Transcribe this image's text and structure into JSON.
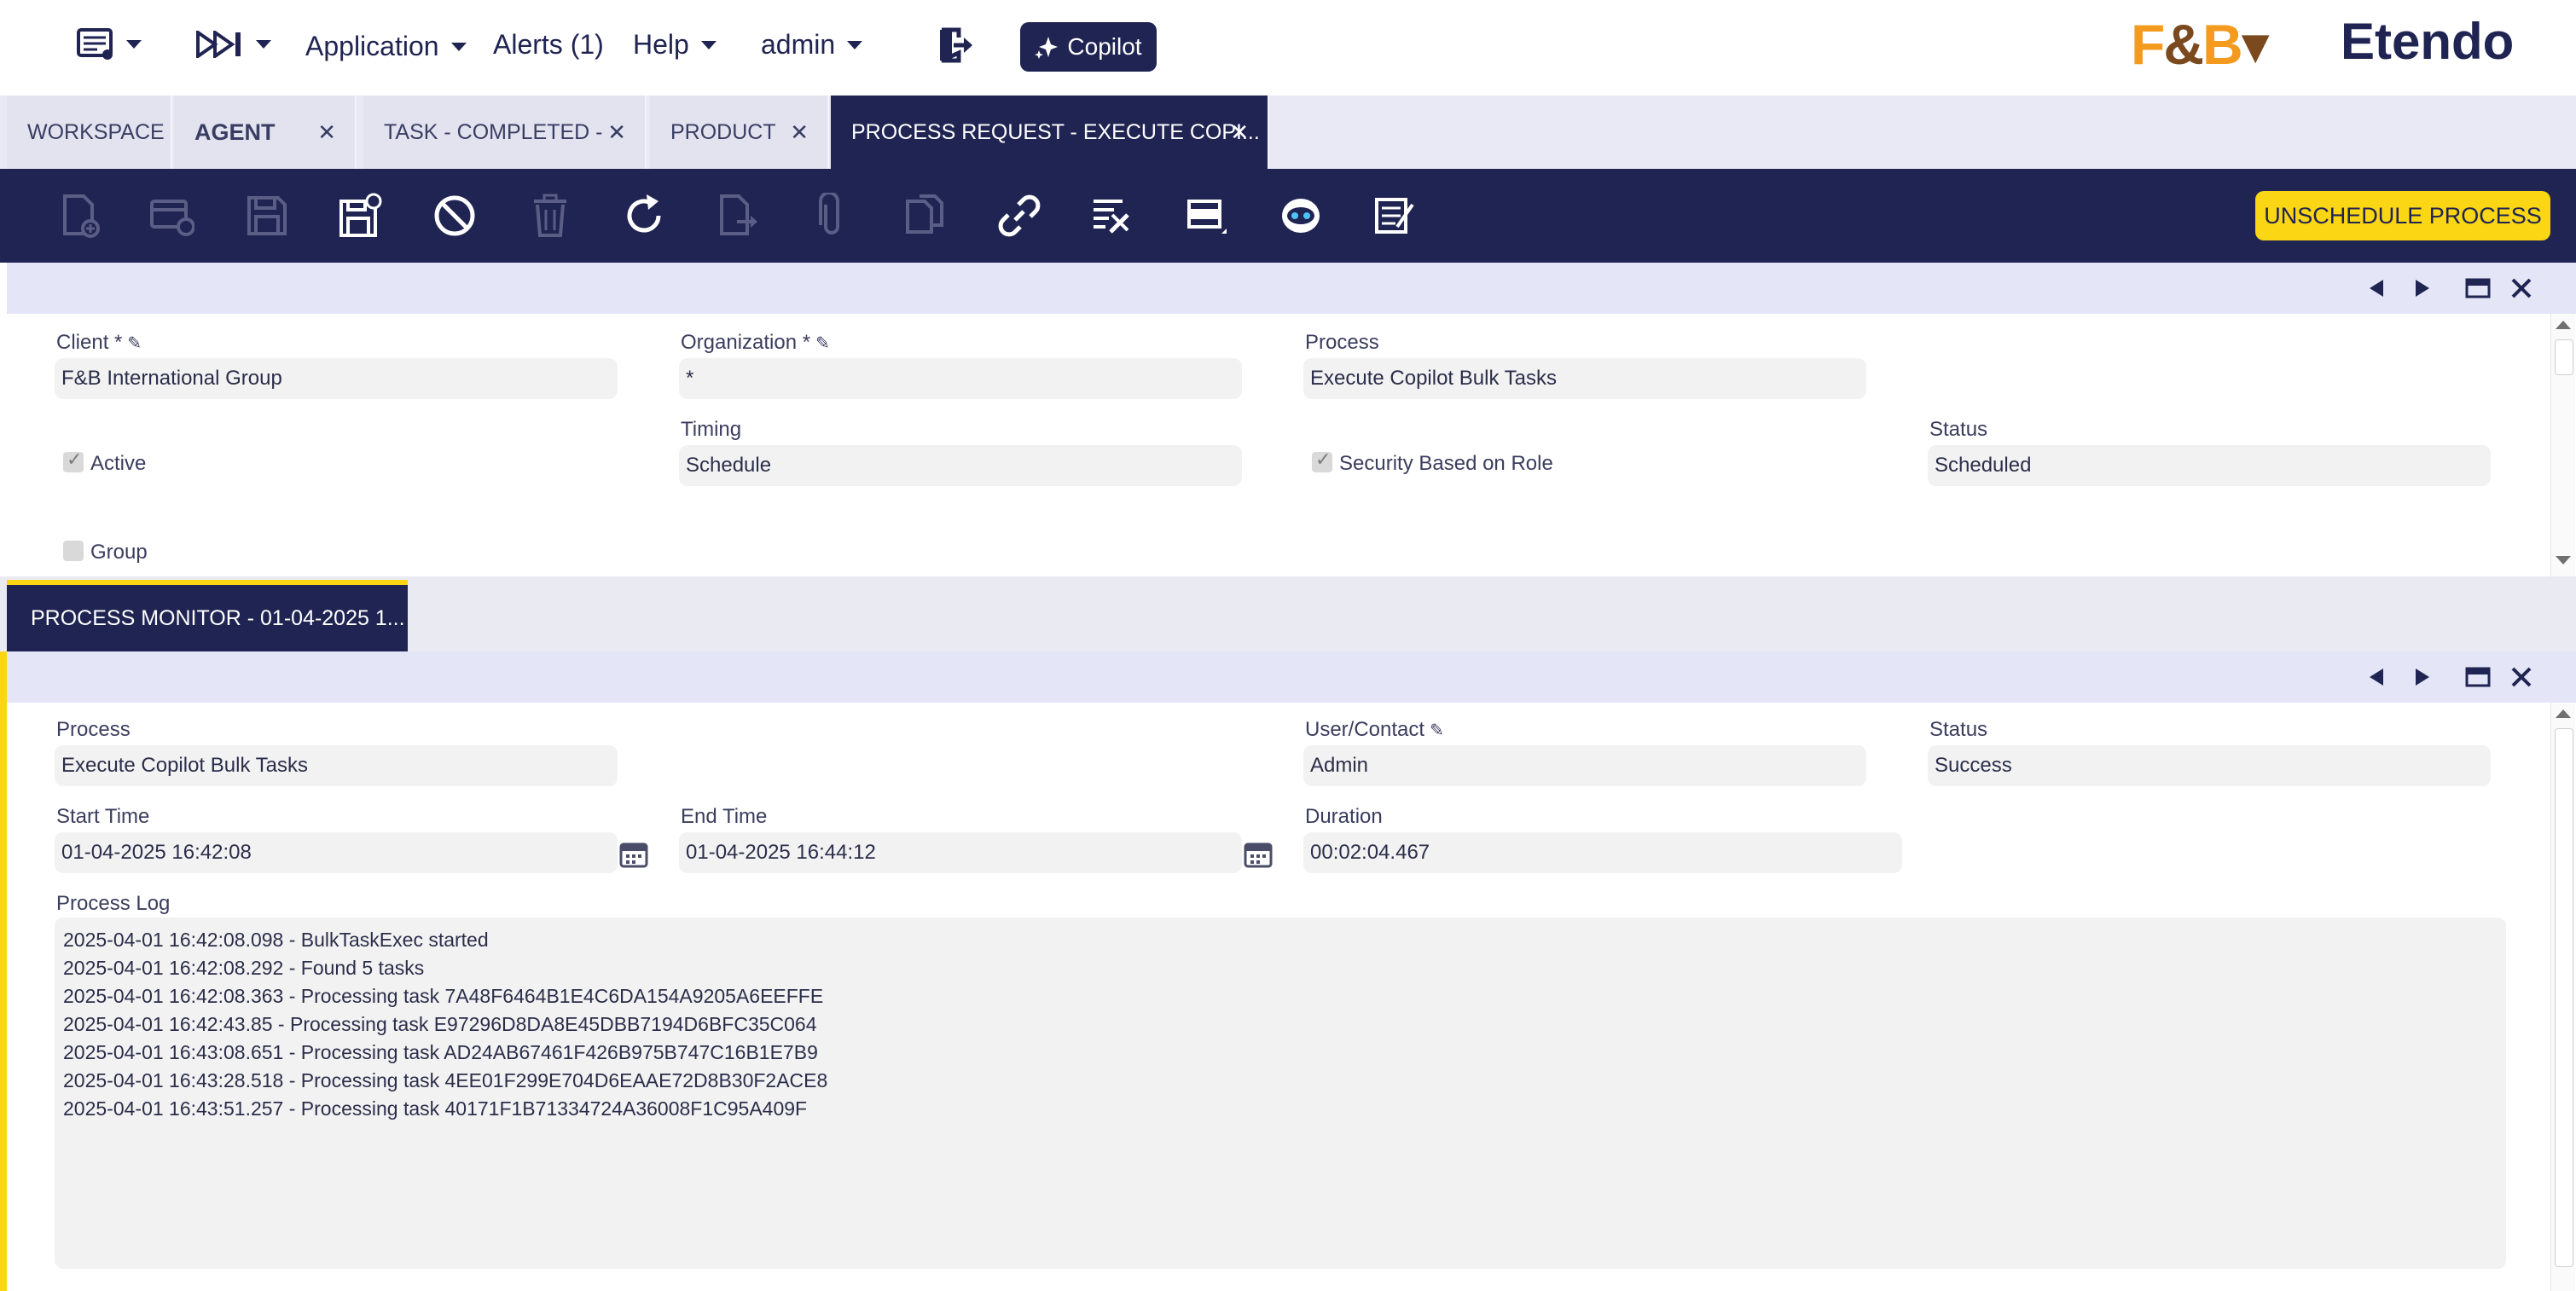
{
  "nav": {
    "application_label": "Application",
    "alerts_label": "Alerts (1)",
    "help_label": "Help",
    "user_label": "admin",
    "copilot_label": "Copilot",
    "brand_logo": "F&B",
    "brand_name": "Etendo"
  },
  "window_tabs": [
    {
      "label": "WORKSPACE",
      "closable": false,
      "active": false
    },
    {
      "label": "AGENT",
      "closable": true,
      "active": false
    },
    {
      "label": "TASK - COMPLETED -",
      "closable": true,
      "active": false
    },
    {
      "label": "PRODUCT",
      "closable": true,
      "active": false
    },
    {
      "label": "PROCESS REQUEST - EXECUTE COPI...",
      "closable": true,
      "active": true
    }
  ],
  "toolbar": {
    "icons": [
      "new-document-icon",
      "new-record-icon",
      "save-icon",
      "save-and-close-icon",
      "undo-icon",
      "delete-icon",
      "refresh-icon",
      "export-icon",
      "attachment-icon",
      "copy-icon",
      "link-icon",
      "audit-icon",
      "grid-toggle-icon",
      "copilot-robot-icon",
      "notes-icon"
    ],
    "unschedule_label": "UNSCHEDULE PROCESS",
    "unschedule_accent": "#fad614"
  },
  "header_form": {
    "client_label": "Client *",
    "client_value": "F&B International Group",
    "organization_label": "Organization *",
    "organization_value": "*",
    "process_label": "Process",
    "process_value": "Execute Copilot Bulk Tasks",
    "active_label": "Active",
    "active_checked": true,
    "timing_label": "Timing",
    "timing_value": "Schedule",
    "security_label": "Security Based on Role",
    "security_checked": true,
    "status_label": "Status",
    "status_value": "Scheduled",
    "group_label": "Group",
    "group_checked": false
  },
  "subtab": {
    "label": "PROCESS MONITOR - 01-04-2025 1..."
  },
  "monitor_form": {
    "process_label": "Process",
    "process_value": "Execute Copilot Bulk Tasks",
    "user_label": "User/Contact",
    "user_value": "Admin",
    "status_label": "Status",
    "status_value": "Success",
    "start_label": "Start Time",
    "start_value": "01-04-2025 16:42:08",
    "end_label": "End Time",
    "end_value": "01-04-2025 16:44:12",
    "duration_label": "Duration",
    "duration_value": "00:02:04.467",
    "log_label": "Process Log",
    "log_lines": [
      "2025-04-01 16:42:08.098 - BulkTaskExec started",
      "2025-04-01 16:42:08.292 - Found 5 tasks",
      "2025-04-01 16:42:08.363 - Processing task 7A48F6464B1E4C6DA154A9205A6EEFFE",
      "2025-04-01 16:42:43.85 - Processing task E97296D8DA8E45DBB7194D6BFC35C064",
      "2025-04-01 16:43:08.651 - Processing task AD24AB67461F426B975B747C16B1E7B9",
      "2025-04-01 16:43:28.518 - Processing task 4EE01F299E704D6EAAE72D8B30F2ACE8",
      "2025-04-01 16:43:51.257 - Processing task 40171F1B71334724A36008F1C95A409F"
    ]
  },
  "colors": {
    "navy": "#202452",
    "accent_yellow": "#fad614",
    "section_bar": "#e4e6f7",
    "input_bg": "#f2f2f2"
  }
}
